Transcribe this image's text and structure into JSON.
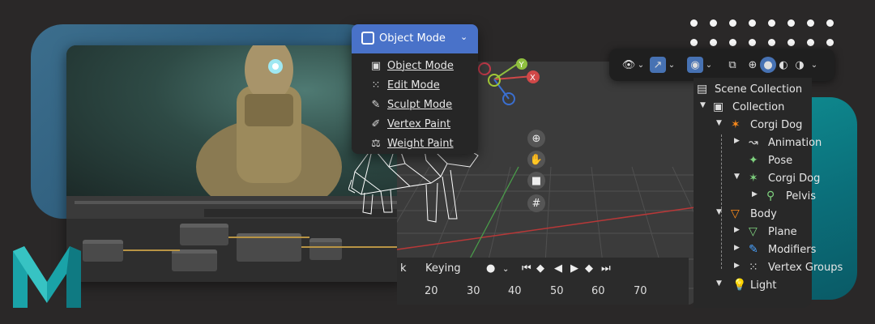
{
  "mode_menu": {
    "header_label": "Object Mode",
    "items": [
      {
        "label": "Object Mode",
        "icon": "object-mode-icon"
      },
      {
        "label": "Edit Mode",
        "icon": "edit-mode-icon"
      },
      {
        "label": "Sculpt Mode",
        "icon": "sculpt-mode-icon"
      },
      {
        "label": "Vertex Paint",
        "icon": "vertex-paint-icon"
      },
      {
        "label": "Weight Paint",
        "icon": "weight-paint-icon"
      }
    ]
  },
  "gizmo": {
    "y_label": "Y",
    "x_label": "X"
  },
  "timeline": {
    "keying_prefix": "k",
    "keying_label": "Keying",
    "frames": [
      "20",
      "30",
      "40",
      "50",
      "60",
      "70"
    ]
  },
  "outliner": {
    "rows": [
      {
        "label": "Scene Collection",
        "icon": "scene-collection-icon"
      },
      {
        "label": "Collection",
        "icon": "collection-icon"
      },
      {
        "label": "Corgi Dog",
        "icon": "armature-icon"
      },
      {
        "label": "Animation",
        "icon": "animation-icon"
      },
      {
        "label": "Pose",
        "icon": "pose-icon"
      },
      {
        "label": "Corgi Dog",
        "icon": "armature-data-icon"
      },
      {
        "label": "Pelvis",
        "icon": "bone-icon"
      },
      {
        "label": "Body",
        "icon": "mesh-icon"
      },
      {
        "label": "Plane",
        "icon": "mesh-data-icon"
      },
      {
        "label": "Modifiers",
        "icon": "wrench-icon"
      },
      {
        "label": "Vertex Groups",
        "icon": "vertex-groups-icon"
      },
      {
        "label": "Light",
        "icon": "light-icon"
      }
    ]
  },
  "colors": {
    "accent_blue": "#4972c9",
    "orange": "#ff8c1a",
    "teal": "#0f8f93",
    "bone_green": "#7fd37f"
  }
}
